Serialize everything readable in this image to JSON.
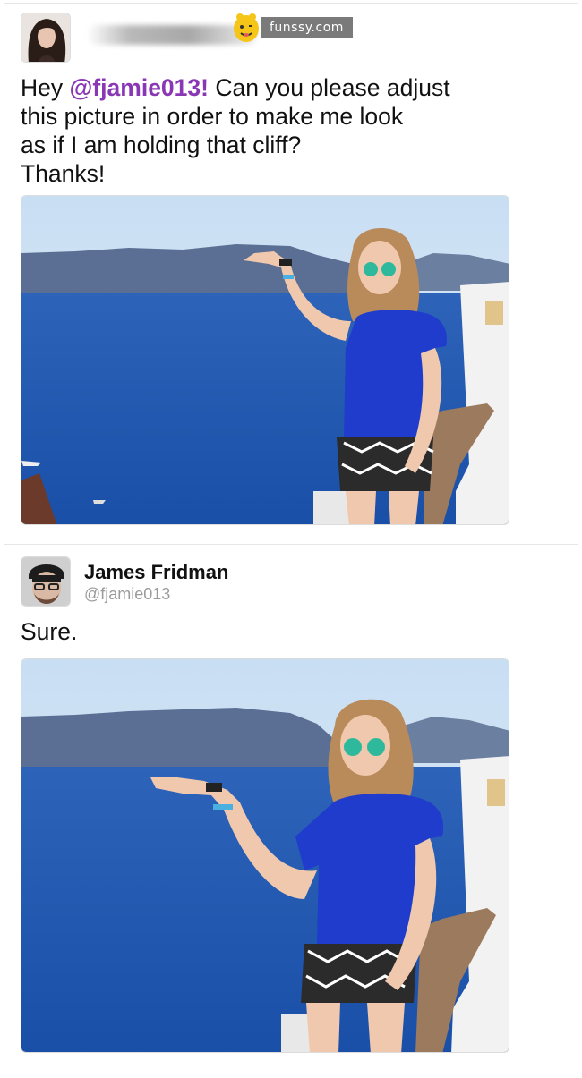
{
  "brand": {
    "site": "funssy.com",
    "mascot_icon": "funssy-mascot-icon"
  },
  "tweet1": {
    "greeting": "Hey ",
    "mention": "@fjamie013!",
    "line1_rest": " Can you please adjust",
    "line2": "this picture in order to make me look",
    "line3": "as if I am holding that cliff?",
    "line4": "Thanks!",
    "author_name_blurred": true
  },
  "tweet2": {
    "name": "James Fridman",
    "handle": "@fjamie013",
    "text": "Sure."
  },
  "colors": {
    "mention": "#8a37b5",
    "handle": "#9a9a9a",
    "sea": "#1f55b5",
    "sky": "#cfe3f5"
  }
}
